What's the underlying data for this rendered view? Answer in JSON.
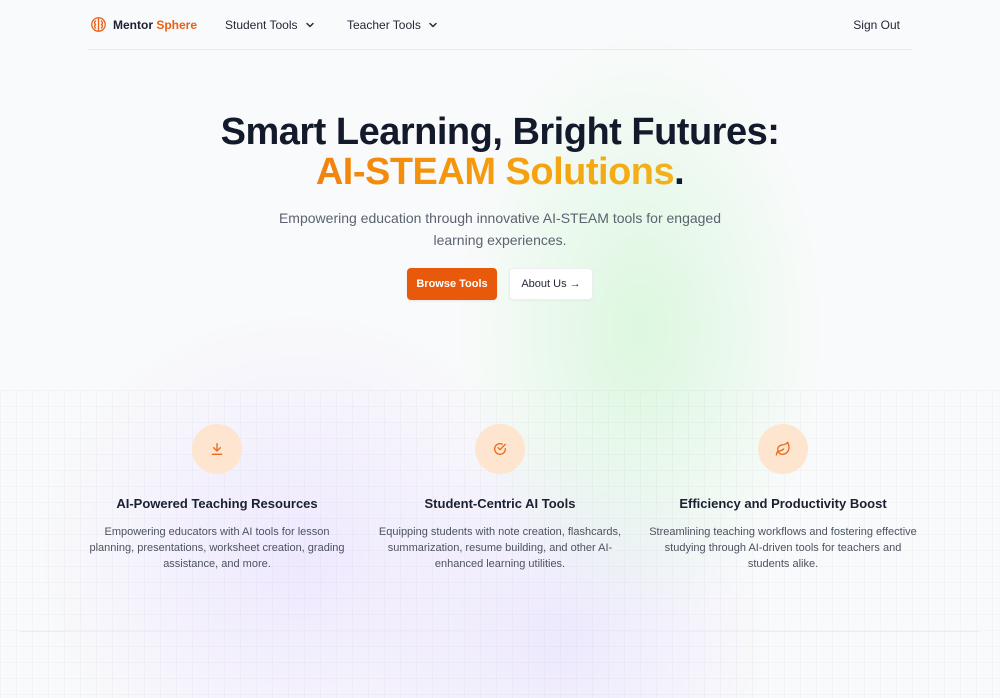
{
  "brand": {
    "name_part1": "Mentor",
    "name_part2": "Sphere",
    "accent_color": "#ea5f13"
  },
  "nav": {
    "student_tools": "Student Tools",
    "teacher_tools": "Teacher Tools",
    "sign_out": "Sign Out"
  },
  "hero": {
    "title_line1": "Smart Learning, Bright Futures:",
    "title_highlight": "AI-STEAM Solutions",
    "title_end": ".",
    "subtitle": "Empowering education through innovative AI-STEAM tools for engaged learning experiences.",
    "primary_button": "Browse Tools",
    "secondary_button": "About Us →"
  },
  "features": [
    {
      "icon": "download-icon",
      "title": "AI-Powered Teaching Resources",
      "description": "Empowering educators with AI tools for lesson planning, presentations, worksheet creation, grading assistance, and more."
    },
    {
      "icon": "check-circle-icon",
      "title": "Student-Centric AI Tools",
      "description": "Equipping students with note creation, flashcards, summarization, resume building, and other AI-enhanced learning utilities."
    },
    {
      "icon": "leaf-icon",
      "title": "Efficiency and Productivity Boost",
      "description": "Streamlining teaching workflows and fostering effective studying through AI-driven tools for teachers and students alike."
    }
  ],
  "colors": {
    "primary": "#e8590c",
    "icon_bg": "#fde5cf",
    "icon_stroke": "#ea6a1c"
  }
}
